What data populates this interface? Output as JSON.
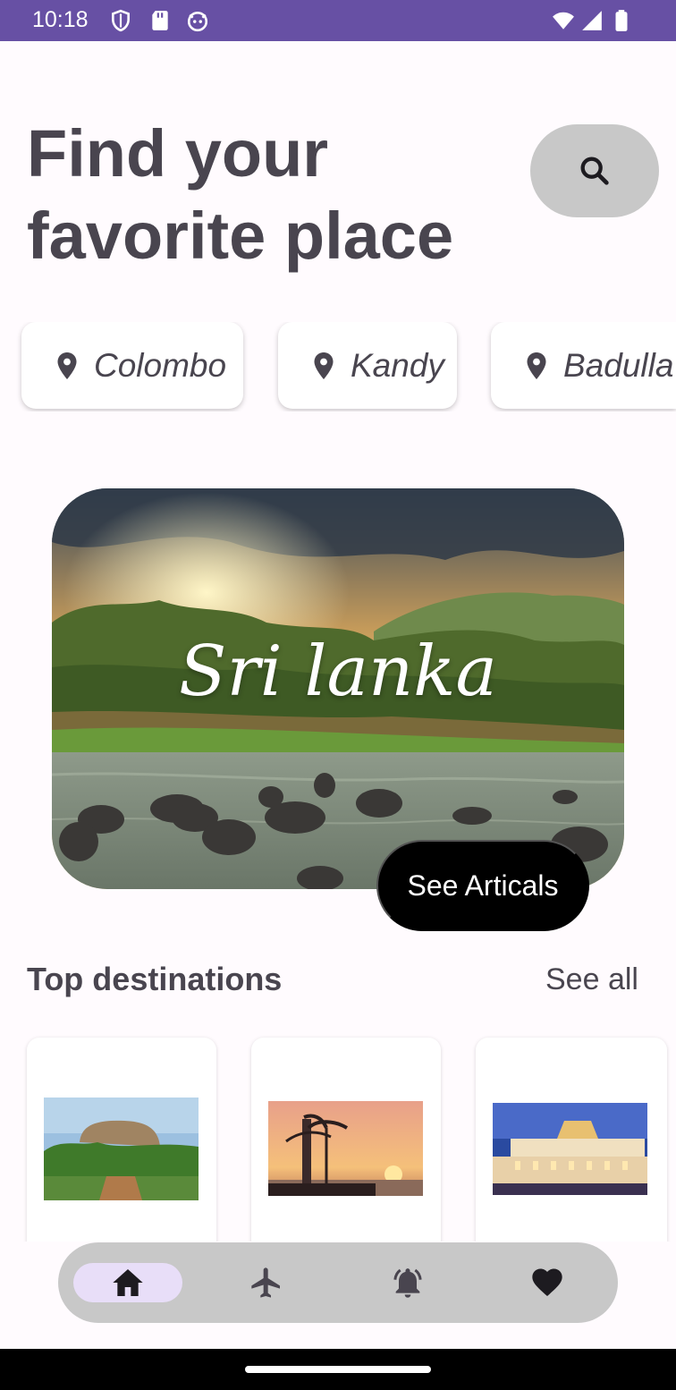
{
  "status_bar": {
    "time": "10:18",
    "left_icons": [
      "shield-icon",
      "sd-card-icon",
      "cat-face-icon"
    ],
    "right_icons": [
      "wifi-icon",
      "signal-icon",
      "battery-icon"
    ],
    "color": "#6750a4"
  },
  "header": {
    "title_line1": "Find your",
    "title_line2": "favorite place",
    "search_icon": "search-icon"
  },
  "locations": [
    {
      "label": "Colombo",
      "icon": "location-pin-icon"
    },
    {
      "label": "Kandy",
      "icon": "location-pin-icon"
    },
    {
      "label": "Badulla",
      "icon": "location-pin-icon"
    }
  ],
  "hero": {
    "title": "Sri lanka",
    "button_label": "See Articals"
  },
  "top_destinations": {
    "title": "Top destinations",
    "see_all": "See all",
    "cards": [
      {
        "image": "sigiriya-rock-image"
      },
      {
        "image": "lighthouse-sunset-image"
      },
      {
        "image": "temple-of-tooth-image"
      }
    ]
  },
  "bottom_nav": {
    "items": [
      {
        "icon": "home-icon",
        "active": true
      },
      {
        "icon": "airplane-icon",
        "active": false
      },
      {
        "icon": "notification-bell-icon",
        "active": false
      },
      {
        "icon": "heart-icon",
        "active": false
      }
    ],
    "active_color": "#e8def8"
  }
}
